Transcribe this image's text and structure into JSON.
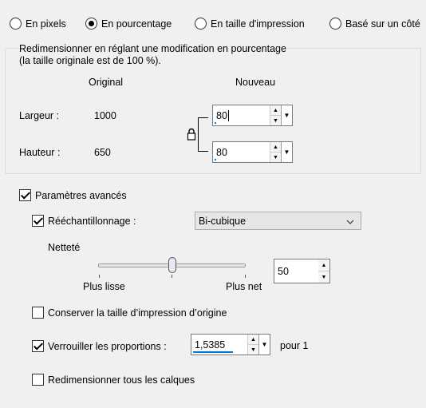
{
  "mode": {
    "options": [
      {
        "label": "En pixels",
        "checked": false
      },
      {
        "label": "En pourcentage",
        "checked": true
      },
      {
        "label": "En taille d'impression",
        "checked": false
      },
      {
        "label": "Basé sur un côté",
        "checked": false
      }
    ]
  },
  "group": {
    "description_line1": "Redimensionner en réglant une modification en pourcentage",
    "description_line2": "(la taille originale est de 100 %).",
    "col_original": "Original",
    "col_new": "Nouveau",
    "width_label": "Largeur :",
    "width_original": "1000",
    "width_new": "80",
    "height_label": "Hauteur :",
    "height_original": "650",
    "height_new": "80"
  },
  "advanced": {
    "label": "Paramètres avancés",
    "checked": true,
    "resample_label": "Rééchantillonnage :",
    "resample_checked": true,
    "resample_value": "Bi-cubique",
    "sharpness_label": "Netteté",
    "slider_min_label": "Plus lisse",
    "slider_max_label": "Plus net",
    "sharpness_value": "50",
    "sharpness_level": 0.5,
    "keep_print_size_label": "Conserver la taille d’impression d’origine",
    "keep_print_size_checked": false,
    "lock_ratio_label": "Verrouiller les proportions :",
    "lock_ratio_checked": true,
    "ratio_value": "1,5385",
    "ratio_suffix": "pour 1",
    "resize_all_layers_label": "Redimensionner tous les calques",
    "resize_all_layers_checked": false
  },
  "icons": {
    "spin_up": "triangle-up",
    "spin_down": "triangle-down",
    "dropdown": "chevron-down",
    "lock": "padlock"
  }
}
